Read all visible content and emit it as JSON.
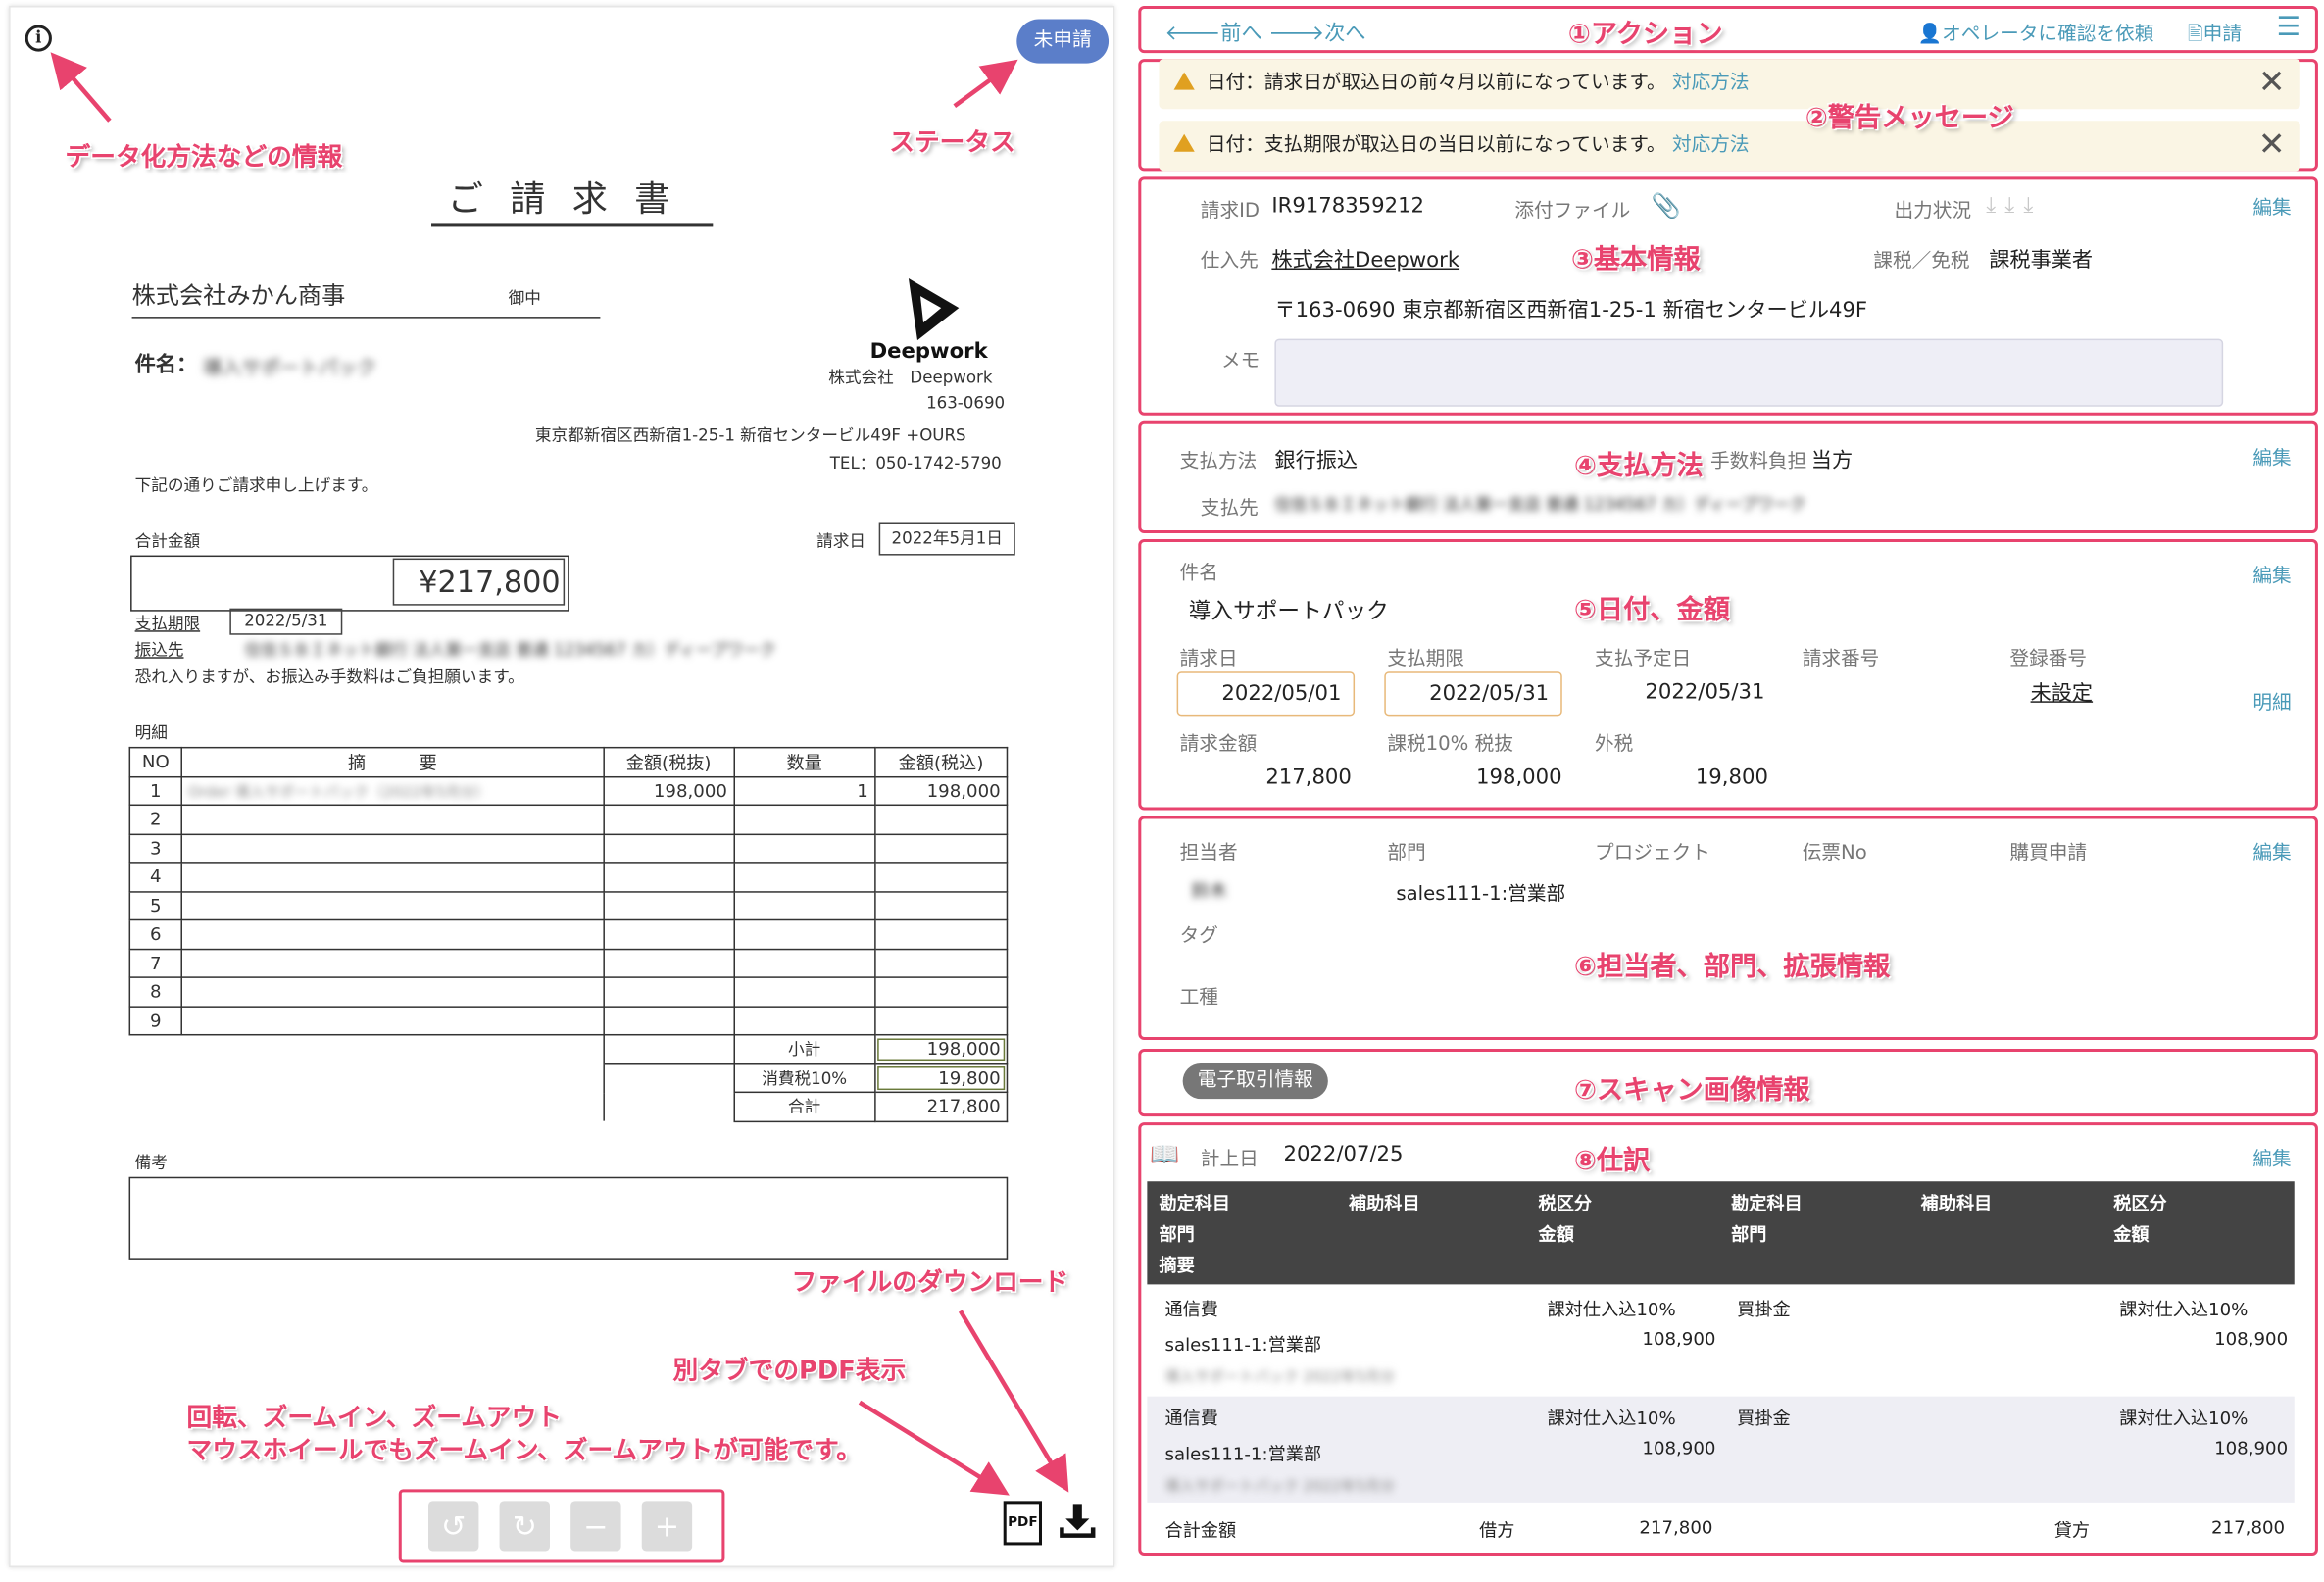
{
  "left": {
    "info_icon": "info-icon",
    "status": "未申請",
    "title": "ご請求書",
    "to_name": "株式会社みかん商事",
    "to_suffix": "御中",
    "subject_label": "件名：",
    "subject_value": "導入サポートパック",
    "company_logo_text": "Deepwork",
    "company_name": "株式会社　Deepwork",
    "zip": "163-0690",
    "address": "東京都新宿区西新宿1-25-1 新宿センタービル49F +OURS",
    "tel": "TEL：050-1742-5790",
    "intro": "下記の通りご請求申し上げます。",
    "total_label": "合計金額",
    "total_value": "¥217,800",
    "invoice_date_label": "請求日",
    "invoice_date": "2022年5月1日",
    "due_label": "支払期限",
    "due_value": "2022/5/31",
    "transfer_label": "振込先",
    "transfer_value": "住信ＳＢＩネット銀行 法人第一支店 普通 1234567 カ）ディープワーク",
    "fee_note": "恐れ入りますが、お振込み手数料はご負担願います。",
    "detail_label": "明細",
    "table_headers": [
      "NO",
      "摘　　　要",
      "金額(税抜)",
      "数量",
      "金額(税込)"
    ],
    "row1": {
      "no": "1",
      "desc": "Order 導入サポートパック（2022年5月分）",
      "amount": "198,000",
      "qty": "1",
      "amount_tax": "198,000"
    },
    "row_numbers": [
      "2",
      "3",
      "4",
      "5",
      "6",
      "7",
      "8",
      "9"
    ],
    "subtotal_label": "小計",
    "subtotal": "198,000",
    "tax_label": "消費税10%",
    "tax": "19,800",
    "sum_label": "合計",
    "sum": "217,800",
    "remarks_label": "備考"
  },
  "toolbar": {
    "rotate_left": "↺",
    "rotate_right": "↻",
    "zoom_out": "−",
    "zoom_in": "+",
    "pdf": "PDF"
  },
  "actions": {
    "prev": "前へ",
    "next": "次へ",
    "confirm": "オペレータに確認を依頼",
    "apply": "申請"
  },
  "warnings": {
    "w1": "日付：請求日が取込日の前々月以前になっています。",
    "w2": "日付：支払期限が取込日の当日以前になっています。",
    "link": "対応方法"
  },
  "basic": {
    "id_label": "請求ID",
    "id": "IR9178359212",
    "attach_label": "添付ファイル",
    "output_label": "出力状況",
    "edit": "編集",
    "supplier_label": "仕入先",
    "supplier": "株式会社Deepwork",
    "tax_label": "課税／免税",
    "tax_value": "課税事業者",
    "address": "〒163-0690 東京都新宿区西新宿1-25-1 新宿センタービル49F",
    "memo_label": "メモ"
  },
  "payment": {
    "method_label": "支払方法",
    "method": "銀行振込",
    "fee_label": "手数料負担",
    "fee": "当方",
    "dest_label": "支払先",
    "dest": "住信ＳＢＩネット銀行 法人第一支店 普通 1234567 カ）ディープワーク",
    "edit": "編集"
  },
  "dates": {
    "subject_label": "件名",
    "subject": "導入サポートパック",
    "edit": "編集",
    "detail": "明細",
    "invoice_date_label": "請求日",
    "invoice_date": "2022/05/01",
    "due_label": "支払期限",
    "due": "2022/05/31",
    "pay_date_label": "支払予定日",
    "pay_date": "2022/05/31",
    "invoice_no_label": "請求番号",
    "reg_no_label": "登録番号",
    "reg_no": "未設定",
    "amount_label": "請求金額",
    "amount": "217,800",
    "taxable_label": "課税10% 税抜",
    "taxable": "198,000",
    "ext_tax_label": "外税",
    "ext_tax": "19,800"
  },
  "owner": {
    "owner_label": "担当者",
    "owner": "鈴木",
    "dept_label": "部門",
    "dept": "sales111-1:営業部",
    "project_label": "プロジェクト",
    "voucher_label": "伝票No",
    "purchase_label": "購買申請",
    "tag_label": "タグ",
    "work_label": "工種",
    "edit": "編集"
  },
  "scan": {
    "badge": "電子取引情報"
  },
  "journal": {
    "date_label": "計上日",
    "date": "2022/07/25",
    "edit": "編集",
    "headers": {
      "acc": "勘定科目",
      "sub": "補助科目",
      "taxc": "税区分",
      "dept": "部門",
      "amount": "金額",
      "memo": "摘要"
    },
    "rows": [
      {
        "dr_acc": "通信費",
        "dr_tax": "課対仕入込10%",
        "dr_dept": "sales111-1:営業部",
        "dr_amount": "108,900",
        "cr_acc": "買掛金",
        "cr_tax": "課対仕入込10%",
        "cr_amount": "108,900",
        "memo": "導入サポートパック 2022年5月分"
      },
      {
        "dr_acc": "通信費",
        "dr_tax": "課対仕入込10%",
        "dr_dept": "sales111-1:営業部",
        "dr_amount": "108,900",
        "cr_acc": "買掛金",
        "cr_tax": "課対仕入込10%",
        "cr_amount": "108,900",
        "memo": "導入サポートパック 2022年5月分"
      }
    ],
    "total_label": "合計金額",
    "debit_label": "借方",
    "debit": "217,800",
    "credit_label": "貸方",
    "credit": "217,800"
  },
  "annotations": {
    "a_info": "データ化方法などの情報",
    "a_status": "ステータス",
    "a_tools": "回転、ズームイン、ズームアウト",
    "a_tools2": "マウスホイールでもズームイン、ズームアウトが可能です。",
    "a_pdf": "別タブでのPDF表示",
    "a_dl": "ファイルのダウンロード",
    "s1": "①アクション",
    "s2": "②警告メッセージ",
    "s3": "③基本情報",
    "s4": "④支払方法",
    "s5": "⑤日付、金額",
    "s6": "⑥担当者、部門、拡張情報",
    "s7": "⑦スキャン画像情報",
    "s8": "⑧仕訳"
  },
  "colors": {
    "accent": "#e8436e",
    "link": "#4a9ab8",
    "status": "#5b7ec9"
  }
}
